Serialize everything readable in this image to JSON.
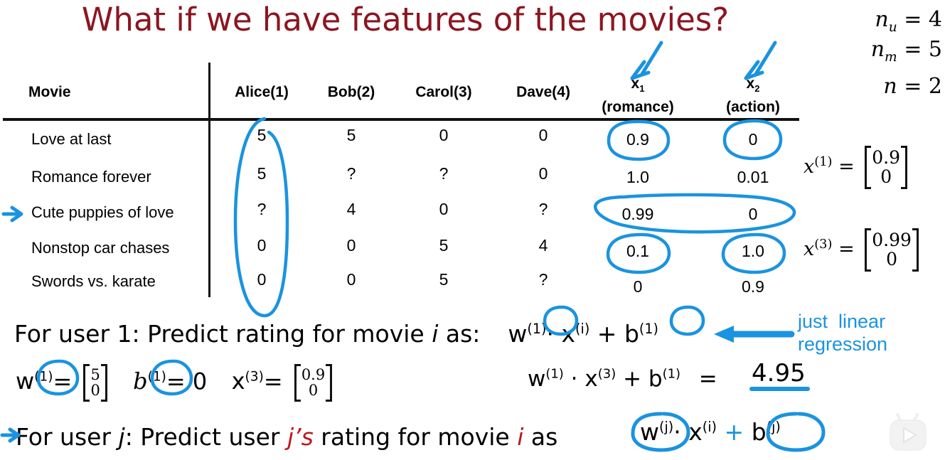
{
  "slide": {
    "title": "What if we have features of the movies?",
    "title_color": "#8c1620",
    "ink_color": "#1a93e0",
    "accent_red": "#c0161d"
  },
  "constants": [
    {
      "name": "n_u",
      "base": "n",
      "sub": "u",
      "eq": "=",
      "value": "4"
    },
    {
      "name": "n_m",
      "base": "n",
      "sub": "m",
      "eq": "=",
      "value": "5"
    },
    {
      "name": "n",
      "base": "n",
      "sub": "",
      "eq": "=",
      "value": "2"
    }
  ],
  "table": {
    "headers": {
      "movie": "Movie",
      "users": [
        "Alice(1)",
        "Bob(2)",
        "Carol(3)",
        "Dave(4)"
      ],
      "features": [
        {
          "symbol": "x",
          "sub": "1",
          "caption": "(romance)"
        },
        {
          "symbol": "x",
          "sub": "2",
          "caption": "(action)"
        }
      ]
    },
    "rows": [
      {
        "movie": "Love at last",
        "ratings": [
          "5",
          "5",
          "0",
          "0"
        ],
        "features": [
          "0.9",
          "0"
        ]
      },
      {
        "movie": "Romance forever",
        "ratings": [
          "5",
          "?",
          "?",
          "0"
        ],
        "features": [
          "1.0",
          "0.01"
        ]
      },
      {
        "movie": "Cute puppies of love",
        "ratings": [
          "?",
          "4",
          "0",
          "?"
        ],
        "features": [
          "0.99",
          "0"
        ]
      },
      {
        "movie": "Nonstop car chases",
        "ratings": [
          "0",
          "0",
          "5",
          "4"
        ],
        "features": [
          "0.1",
          "1.0"
        ]
      },
      {
        "movie": "Swords vs. karate",
        "ratings": [
          "0",
          "0",
          "5",
          "?"
        ],
        "features": [
          "0",
          "0.9"
        ]
      }
    ]
  },
  "vectors": [
    {
      "label": "x",
      "sup": "(1)",
      "eq": "=",
      "rows": [
        "0.9",
        "0"
      ]
    },
    {
      "label": "x",
      "sup": "(3)",
      "eq": "=",
      "rows": [
        "0.99",
        "0"
      ]
    }
  ],
  "user1_line": {
    "prefix": "For user 1: Predict rating for movie ",
    "italic_i": "i",
    "suffix": " as:",
    "formula": {
      "w": "w",
      "w_sup": "(1)",
      "dot": "·",
      "x": "x",
      "x_sup": "(i)",
      "plus": "+",
      "b": "b",
      "b_sup": "(1)"
    }
  },
  "annotation_just_linear": "just  linear\nregression",
  "params_line": {
    "w": "w",
    "w_sup": "(1)",
    "w_eq": "=",
    "w_vec": [
      "5",
      "0"
    ],
    "b": "b",
    "b_sup": "(1)",
    "b_eq": "=",
    "b_val": "0",
    "x": "x",
    "x_sup": "(3)",
    "x_eq": "=",
    "x_vec": [
      "0.9",
      "0"
    ]
  },
  "result_line": {
    "w": "w",
    "w_sup": "(1)",
    "dot": "·",
    "x": "x",
    "x_sup": "(3)",
    "plus": "+",
    "b": "b",
    "b_sup": "(1)",
    "eq": "=",
    "value": "4.95"
  },
  "userj_line": {
    "p1": "For user ",
    "j1": "j",
    "p2": ": Predict user ",
    "js": "j’s",
    "p3": " rating for movie ",
    "i": "i",
    "p4": " as",
    "formula": {
      "w": "w",
      "w_sup": "(j)",
      "dot": "·",
      "x": "x",
      "x_sup": "(i)",
      "plus": "+",
      "b": "b",
      "b_sup": "(j)"
    }
  },
  "watermark": {
    "name": "tv-play-logo"
  }
}
